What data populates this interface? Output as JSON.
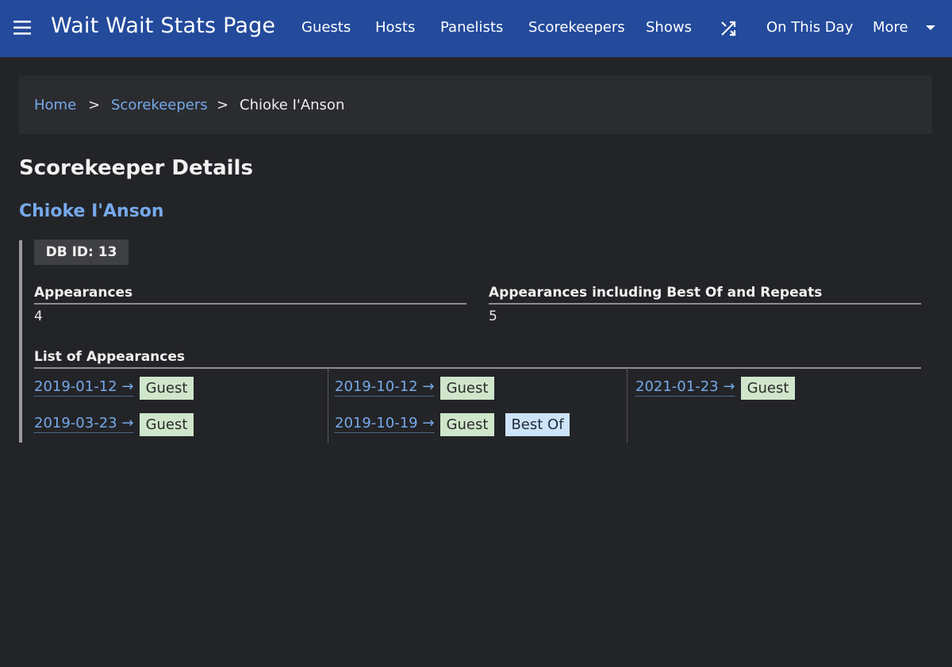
{
  "header": {
    "title": "Wait Wait Stats Page",
    "nav": {
      "guests": "Guests",
      "hosts": "Hosts",
      "panelists": "Panelists",
      "scorekeepers": "Scorekeepers",
      "shows": "Shows",
      "on_this_day": "On This Day",
      "more": "More"
    },
    "icons": {
      "menu": "hamburger-menu-icon",
      "random": "shuffle-icon",
      "more": "caret-down-icon"
    }
  },
  "breadcrumb": {
    "home": "Home",
    "sep1": ">",
    "scorekeepers": "Scorekeepers",
    "sep2": ">",
    "current": "Chioke I'Anson"
  },
  "main": {
    "title": "Scorekeeper Details",
    "name": "Chioke I'Anson",
    "db_id": "DB ID: 13",
    "appearances_label": "Appearances",
    "appearances_value": "4",
    "appearances_all_label": "Appearances including Best Of and Repeats",
    "appearances_all_value": "5",
    "list_label": "List of Appearances",
    "appearances": [
      {
        "date": "2019-01-12 →",
        "badges": [
          "Guest"
        ]
      },
      {
        "date": "2019-03-23 →",
        "badges": [
          "Guest"
        ]
      },
      {
        "date": "2019-10-12 →",
        "badges": [
          "Guest"
        ]
      },
      {
        "date": "2019-10-19 →",
        "badges": [
          "Guest",
          "Best Of"
        ]
      },
      {
        "date": "2021-01-23 →",
        "badges": [
          "Guest"
        ]
      }
    ]
  },
  "colors": {
    "header_bg": "#234a9b",
    "page_bg": "#232427",
    "link": "#76a9ea",
    "guest_badge": "#cfe6cb",
    "bestof_badge": "#cde3f7"
  }
}
